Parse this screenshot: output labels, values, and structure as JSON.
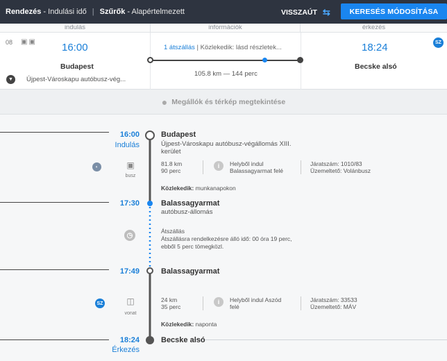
{
  "topbar": {
    "sort_label": "Rendezés",
    "sort_value": "Indulási idő",
    "filter_label": "Szűrők",
    "filter_value": "Alapértelmezett",
    "reverse_label": "VISSZAÚT",
    "modify_label": "KERESÉS MÓDOSÍTÁSA"
  },
  "summary": {
    "col_departure": "indulás",
    "col_info": "információk",
    "col_arrival": "érkezés",
    "row_number": "08",
    "dep_time": "16:00",
    "dep_city": "Budapest",
    "dep_stop": "Újpest-Városkapu autóbusz-vég...",
    "transfers": "1 átszállás",
    "info_rest": " | Közlekedik: lásd részletek...",
    "distance_duration": "105.8 km — 144 perc",
    "arr_time": "18:24",
    "arr_city": "Becske alsó",
    "badge": "SZ"
  },
  "map_link": "Megállók és térkép megtekintése",
  "stops": [
    {
      "time": "16:00",
      "label": "Indulás",
      "name": "Budapest",
      "sub": "Újpest-Városkapu autóbusz-végállomás XIII. kerület"
    },
    {
      "time": "17:30",
      "label": "",
      "name": "Balassagyarmat",
      "sub": "autóbusz-állomás"
    },
    {
      "time": "17:49",
      "label": "",
      "name": "Balassagyarmat",
      "sub": ""
    },
    {
      "time": "18:24",
      "label": "Érkezés",
      "name": "Becske alsó",
      "sub": ""
    }
  ],
  "legs": [
    {
      "vehicle": "busz",
      "km": "81.8 km",
      "min": "90 perc",
      "start_note_1": "Helyből indul",
      "start_note_2": "Balassagyarmat felé",
      "trip_no": "Járatszám: 1010/83",
      "operator": "Üzemeltető: Volánbusz",
      "runs_label": "Közlekedik:",
      "runs_value": "munkanapokon"
    },
    {
      "vehicle": "vonat",
      "km": "24 km",
      "min": "35 perc",
      "start_note_1": "Helyből indul Aszód",
      "start_note_2": "felé",
      "trip_no": "Járatszám: 33533",
      "operator": "Üzemeltető: MÁV",
      "runs_label": "Közlekedik:",
      "runs_value": "naponta",
      "badge": "SZ"
    }
  ],
  "transfer": {
    "title": "Átszállás",
    "line1": "Átszállásra rendelkezésre álló idő: 00 óra 19 perc,",
    "line2": "ebből 5 perc tömegközl."
  },
  "colors": {
    "accent": "#1a86f0",
    "topbar": "#2e3440",
    "time": "#1a7fd8"
  }
}
